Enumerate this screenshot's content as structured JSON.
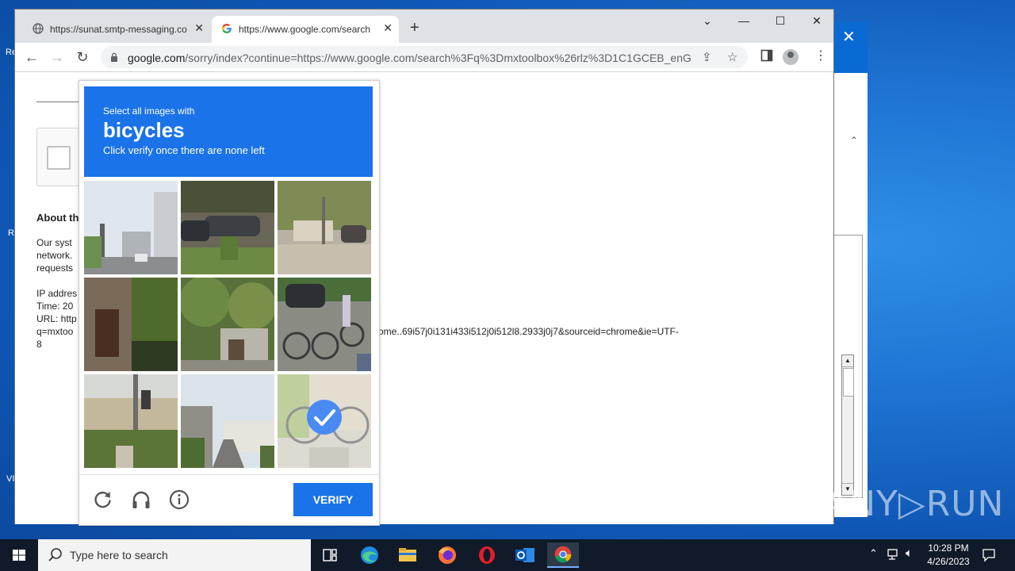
{
  "browser": {
    "tabs": [
      {
        "title": "https://sunat.smtp-messaging.co",
        "active": false
      },
      {
        "title": "https://www.google.com/search",
        "active": true
      }
    ],
    "address": {
      "host": "google.com",
      "path": "/sorry/index?continue=https://www.google.com/search%3Fq%3Dmxtoolbox%26rlz%3D1C1GCEB_enGB..."
    }
  },
  "page": {
    "about_heading": "About th",
    "para_lines": [
      "Our syst",
      "network.",
      "requests"
    ],
    "ip_lines": [
      "IP addres",
      "Time: 20",
      "URL: http",
      "q=mxtoo",
      "8"
    ],
    "url_tail": "ome..69i57j0i131i433i512j0i512l8.2933j0j7&sourceid=chrome&ie=UTF-"
  },
  "captcha": {
    "instruction_top": "Select all images with",
    "target": "bicycles",
    "instruction_bottom": "Click verify once there are none left",
    "selected_tiles": [
      8
    ],
    "verify_label": "VERIFY"
  },
  "watermark": "ANY▷RUN",
  "taskbar": {
    "search_placeholder": "Type here to search",
    "time": "10:28 PM",
    "date": "4/26/2023"
  }
}
